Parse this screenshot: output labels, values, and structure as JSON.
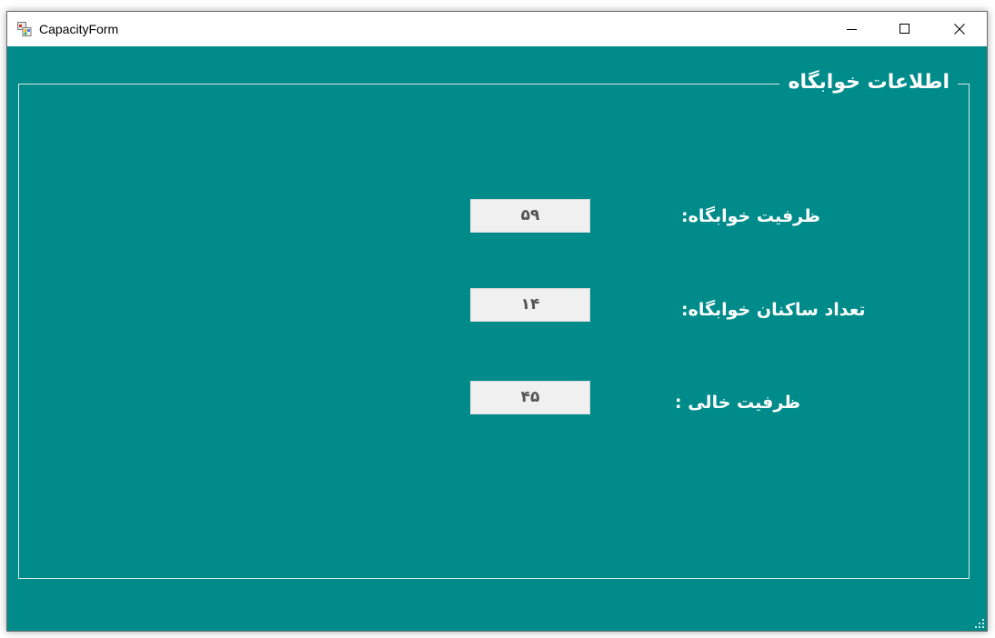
{
  "window": {
    "title": "CapacityForm",
    "icon": "winforms-app-icon",
    "controls": [
      "minimize-icon",
      "maximize-icon",
      "close-icon"
    ]
  },
  "group": {
    "title": "اطلاعات خوابگاه"
  },
  "fields": [
    {
      "label": "ظرفیت خوابگاه:",
      "value": "۵۹"
    },
    {
      "label": "تعداد ساکنان خوابگاه:",
      "value": "۱۴"
    },
    {
      "label": "ظرفیت خالی :",
      "value": "۴۵"
    }
  ],
  "colors": {
    "background": "#008b8b",
    "text": "#ffffff",
    "field_bg": "#f0f0f0"
  }
}
